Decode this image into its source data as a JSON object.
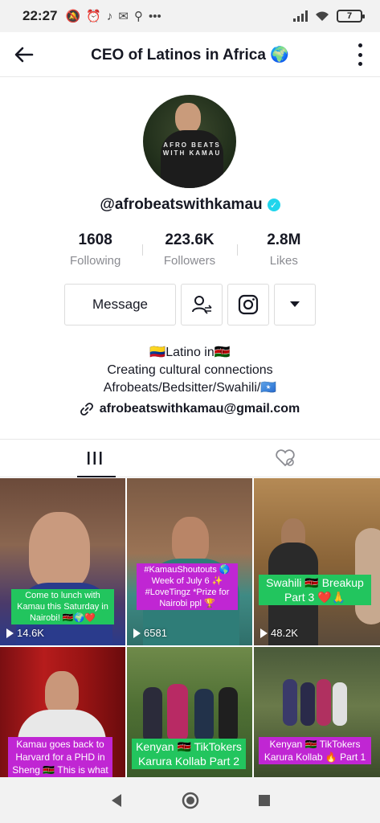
{
  "status_bar": {
    "time": "22:27",
    "battery": "7"
  },
  "header": {
    "title": "CEO of Latinos in Africa 🌍"
  },
  "profile": {
    "avatar_shirt_text": "AFRO BEATS WITH KAMAU",
    "username": "@afrobeatswithkamau",
    "stats": [
      {
        "value": "1608",
        "label": "Following"
      },
      {
        "value": "223.6K",
        "label": "Followers"
      },
      {
        "value": "2.8M",
        "label": "Likes"
      }
    ]
  },
  "actions": {
    "message_label": "Message"
  },
  "bio": {
    "line1": "🇨🇴Latino in🇰🇪",
    "line2": "Creating cultural connections",
    "line3": "Afrobeats/Bedsitter/Swahili/🇸🇴",
    "link": "afrobeatswithkamau@gmail.com"
  },
  "videos": [
    {
      "caption": "Come to lunch with Kamau this Saturday in Nairobi! 🇰🇪🌍❤️",
      "views": "14.6K"
    },
    {
      "caption": "#KamauShoutouts 🌎 Week of July 6 ✨ #LoveTingz *Prize for Nairobi ppl 🏆",
      "views": "6581"
    },
    {
      "caption": "Swahili 🇰🇪 Breakup Part 3 ❤️🙏",
      "views": "48.2K"
    },
    {
      "caption": "Kamau goes back to Harvard for a PHD in Sheng 🇰🇪 This is what it",
      "views": ""
    },
    {
      "caption": "Kenyan 🇰🇪 TikTokers Karura Kollab Part 2",
      "views": ""
    },
    {
      "caption": "Kenyan 🇰🇪 TikTokers Karura Kollab 🔥 Part 1",
      "views": ""
    }
  ],
  "colors": {
    "verified": "#20d5ec",
    "caption_green": "#22c55e",
    "caption_purple": "#c026d3"
  }
}
